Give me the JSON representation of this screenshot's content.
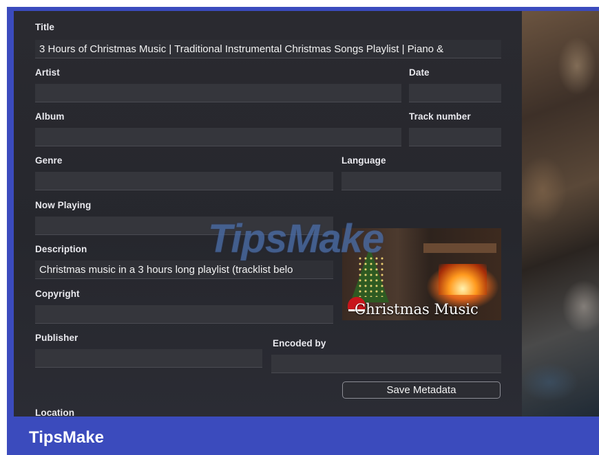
{
  "fields": {
    "title": {
      "label": "Title",
      "value": "3 Hours of Christmas Music | Traditional Instrumental Christmas Songs Playlist | Piano &"
    },
    "artist": {
      "label": "Artist",
      "value": ""
    },
    "date": {
      "label": "Date",
      "value": ""
    },
    "album": {
      "label": "Album",
      "value": ""
    },
    "track_number": {
      "label": "Track number",
      "value": ""
    },
    "genre": {
      "label": "Genre",
      "value": ""
    },
    "language": {
      "label": "Language",
      "value": ""
    },
    "now_playing": {
      "label": "Now Playing",
      "value": ""
    },
    "description": {
      "label": "Description",
      "value": "Christmas music in a 3 hours long playlist (tracklist belo"
    },
    "copyright": {
      "label": "Copyright",
      "value": ""
    },
    "publisher": {
      "label": "Publisher",
      "value": ""
    },
    "encoded_by": {
      "label": "Encoded by",
      "value": ""
    },
    "location": {
      "label": "Location"
    }
  },
  "artwork": {
    "caption": "Christmas Music"
  },
  "save_button": {
    "label": "Save Metadata"
  },
  "watermark": {
    "text": "TipsMake"
  },
  "footer": {
    "brand": "TipsMake"
  },
  "colors": {
    "frame": "#3b4bbd",
    "panel": "#2a2a30",
    "field": "#35363c",
    "text": "#e9e9ee"
  }
}
